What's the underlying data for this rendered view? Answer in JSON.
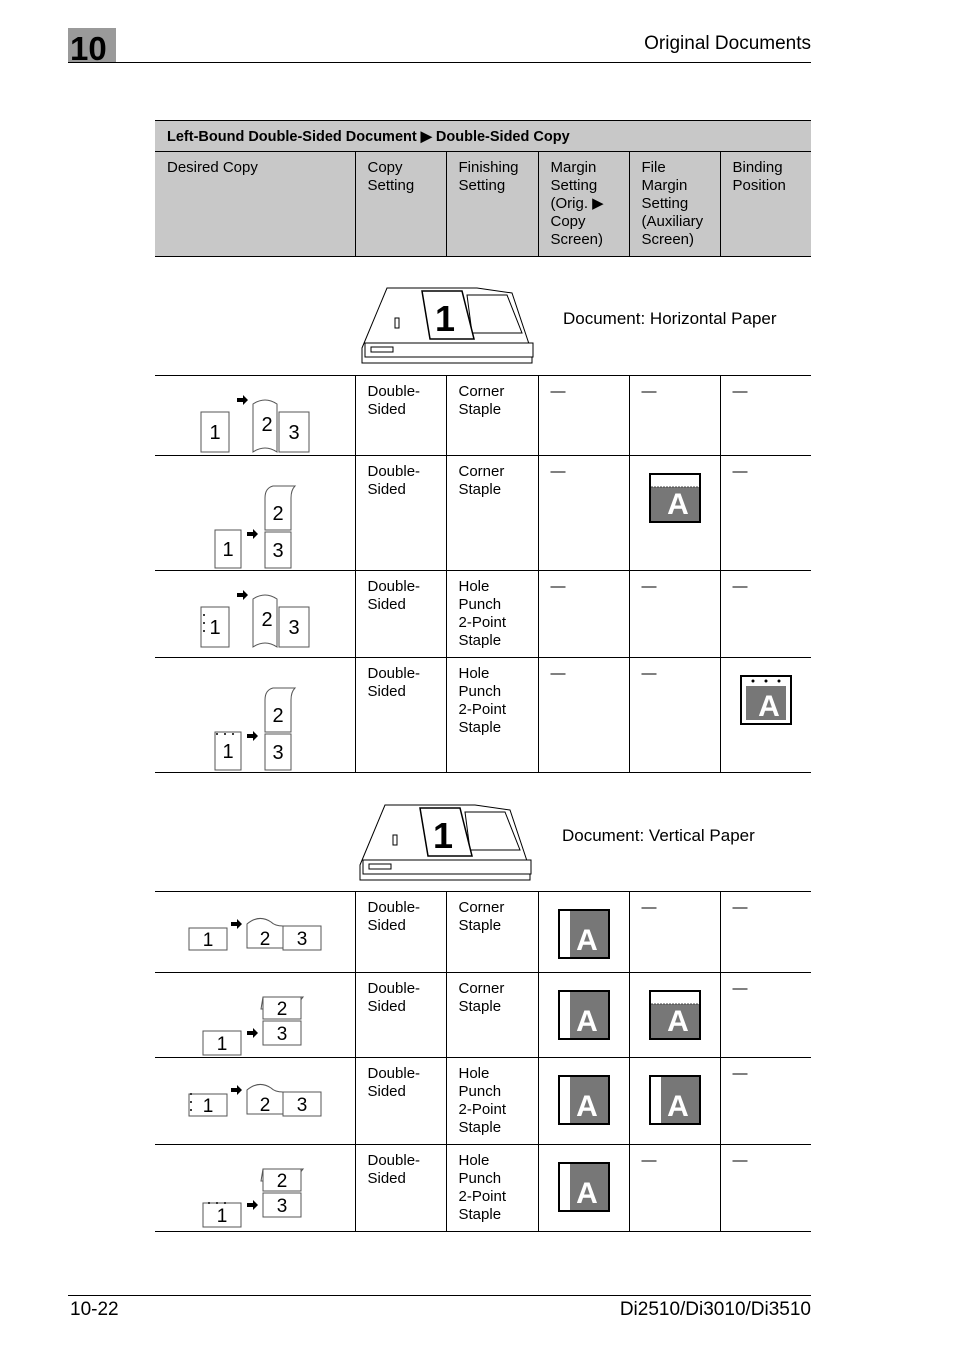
{
  "header": {
    "chapter": "10",
    "title": "Original Documents"
  },
  "footer": {
    "page": "10-22",
    "model": "Di2510/Di3010/Di3510"
  },
  "table": {
    "caption": "Left-Bound Double-Sided Document ▶ Double-Sided Copy",
    "columns": [
      "Desired Copy",
      "Copy Setting",
      "Finishing Setting",
      "Margin Setting (Orig. ▶ Copy Screen)",
      "File Margin Setting (Auxiliary Screen)",
      "Binding Position"
    ],
    "sections": [
      {
        "label": "Document: Horizontal Paper",
        "icon": "document-feeder-icon",
        "page_number": "1",
        "rows": [
          {
            "copy": "Double-Sided",
            "finishing": "Corner Staple",
            "diagram": "book-horizontal",
            "holes": false,
            "pages": [
              "1",
              "2",
              "3"
            ],
            "margin": "—",
            "file_margin": "—",
            "binding": "—"
          },
          {
            "copy": "Double-Sided",
            "finishing": "Corner Staple",
            "diagram": "flip-vertical",
            "holes": false,
            "pages": [
              "1",
              "2",
              "3"
            ],
            "margin": "—",
            "file_margin": "top-margin-icon",
            "binding": "—"
          },
          {
            "copy": "Double-Sided",
            "finishing": "Hole Punch 2-Point Staple",
            "diagram": "book-horizontal",
            "holes": true,
            "pages": [
              "1",
              "2",
              "3"
            ],
            "margin": "—",
            "file_margin": "—",
            "binding": "—"
          },
          {
            "copy": "Double-Sided",
            "finishing": "Hole Punch 2-Point Staple",
            "diagram": "flip-vertical",
            "holes": true,
            "pages": [
              "1",
              "2",
              "3"
            ],
            "margin": "—",
            "file_margin": "—",
            "binding": "top-binding-icon"
          }
        ]
      },
      {
        "label": "Document: Vertical Paper",
        "icon": "document-feeder-icon",
        "page_number": "1",
        "rows": [
          {
            "copy": "Double-Sided",
            "finishing": "Corner Staple",
            "diagram": "book-horizontal-wide",
            "holes": false,
            "pages": [
              "1",
              "2",
              "3"
            ],
            "margin": "left-margin-icon",
            "file_margin": "—",
            "binding": "—"
          },
          {
            "copy": "Double-Sided",
            "finishing": "Corner Staple",
            "diagram": "flip-vertical-wide",
            "holes": false,
            "pages": [
              "1",
              "2",
              "3"
            ],
            "margin": "left-margin-icon",
            "file_margin": "top-margin-icon",
            "binding": "—"
          },
          {
            "copy": "Double-Sided",
            "finishing": "Hole Punch 2-Point Staple",
            "diagram": "book-horizontal-wide",
            "holes": true,
            "pages": [
              "1",
              "2",
              "3"
            ],
            "margin": "left-margin-icon",
            "file_margin": "left-margin-icon",
            "binding": "—"
          },
          {
            "copy": "Double-Sided",
            "finishing": "Hole Punch 2-Point Staple",
            "diagram": "flip-vertical-wide",
            "holes": true,
            "pages": [
              "1",
              "2",
              "3"
            ],
            "margin": "left-margin-icon",
            "file_margin": "—",
            "binding": "—"
          }
        ]
      }
    ]
  }
}
